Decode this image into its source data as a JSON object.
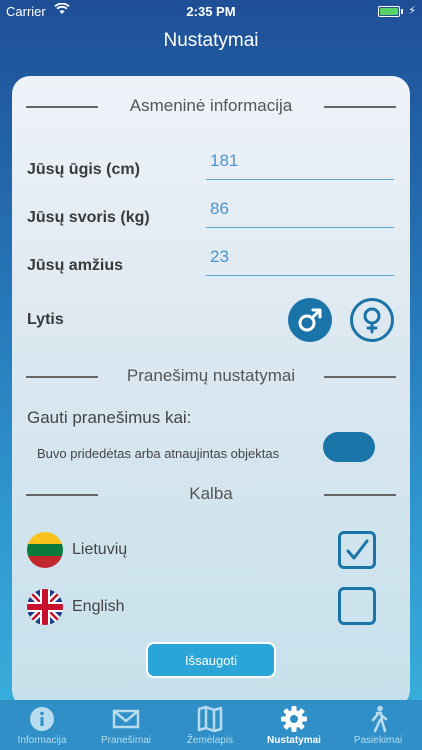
{
  "status_bar": {
    "carrier": "Carrier",
    "time": "2:35 PM"
  },
  "header": {
    "title": "Nustatymai"
  },
  "personal": {
    "title": "Asmeninė informacija",
    "height_label": "Jūsų ūgis (cm)",
    "height_value": "181",
    "weight_label": "Jūsų svoris (kg)",
    "weight_value": "86",
    "age_label": "Jūsų amžius",
    "age_value": "23",
    "gender_label": "Lytis",
    "gender_options": [
      {
        "icon": "male-icon",
        "selected": true
      },
      {
        "icon": "female-icon",
        "selected": false
      }
    ]
  },
  "notifications": {
    "title": "Pranešimų nustatymai",
    "subtitle": "Gauti pranešimus kai:",
    "toggle_label": "Buvo pridedėtas arba atnaujintas objektas",
    "toggle_on": true
  },
  "language": {
    "title": "Kalba",
    "options": [
      {
        "label": "Lietuvių",
        "icon": "lithuania-flag-icon",
        "checked": true
      },
      {
        "label": "English",
        "icon": "uk-flag-icon",
        "checked": false
      }
    ]
  },
  "save_label": "Išsaugoti",
  "tabs": [
    {
      "label": "Informacija",
      "icon": "info-icon"
    },
    {
      "label": "Pranešimai",
      "icon": "mail-icon"
    },
    {
      "label": "Žemėlapis",
      "icon": "map-icon"
    },
    {
      "label": "Nustatymai",
      "icon": "gear-icon",
      "active": true
    },
    {
      "label": "Pasiekimai",
      "icon": "walking-icon"
    }
  ],
  "colors": {
    "accent": "#1b74a8",
    "tab_bar": "#2f8fc6",
    "input_text": "#4b95cf"
  }
}
